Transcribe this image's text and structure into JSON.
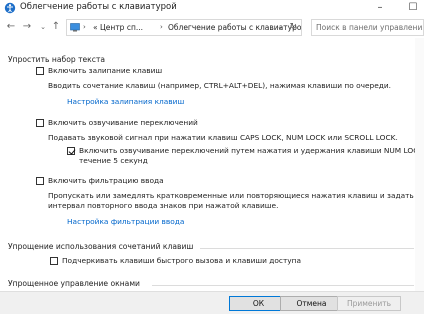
{
  "window": {
    "title": "Облегчение работы с клавиатурой"
  },
  "nav": {
    "crumb1": "« Центр сп...",
    "crumb2": "Облегчение работы с клавиатурой",
    "search_placeholder": "Поиск в панели управления"
  },
  "sections": {
    "s1": {
      "title": "Упростить набор текста",
      "sticky": {
        "label": "Включить залипание клавиш",
        "desc": "Вводить сочетание клавиш (например, CTRL+ALT+DEL), нажимая клавиши по очереди.",
        "link": "Настройка залипания клавиш",
        "checked": false
      },
      "toggle": {
        "label": "Включить озвучивание переключений",
        "desc": "Подавать звуковой сигнал при нажатии клавиш CAPS LOCK, NUM LOCK или SCROLL LOCK.",
        "sub_label_1": "Включить озвучивание переключений путем нажатия и удержания клавиши NUM LOCK в",
        "sub_label_2": "течение 5 секунд",
        "checked": false,
        "sub_checked": true
      },
      "filter": {
        "label": "Включить фильтрацию ввода",
        "desc_1": "Пропускать или замедлять кратковременные или повторяющиеся нажатия клавиш и задать",
        "desc_2": "интервал повторного ввода знаков при нажатой клавише.",
        "link": "Настройка фильтрации ввода",
        "checked": false
      }
    },
    "s2": {
      "title": "Упрощение использования сочетаний клавиш",
      "underline": {
        "label": "Подчеркивать клавиши быстрого вызова и клавиши доступа",
        "checked": false
      }
    },
    "s3": {
      "title": "Упрощенное управление окнами"
    }
  },
  "buttons": {
    "ok": "ОК",
    "cancel": "Отмена",
    "apply": "Применить"
  }
}
